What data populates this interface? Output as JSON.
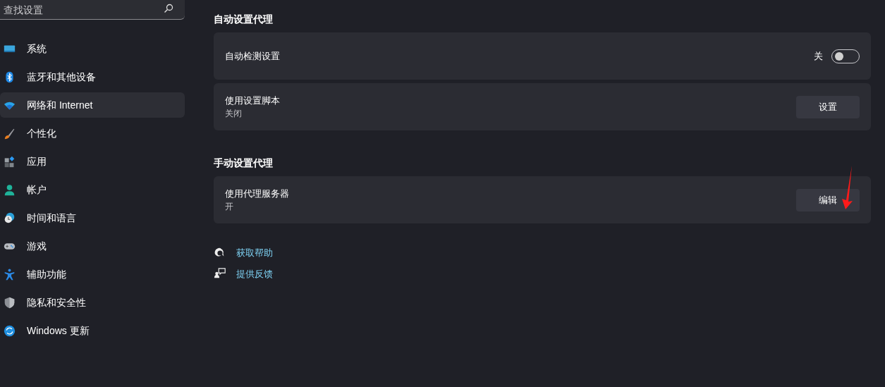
{
  "search": {
    "placeholder": "查找设置"
  },
  "sidebar": {
    "items": [
      {
        "label": "系统",
        "selected": false
      },
      {
        "label": "蓝牙和其他设备",
        "selected": false
      },
      {
        "label": "网络和 Internet",
        "selected": true
      },
      {
        "label": "个性化",
        "selected": false
      },
      {
        "label": "应用",
        "selected": false
      },
      {
        "label": "帐户",
        "selected": false
      },
      {
        "label": "时间和语言",
        "selected": false
      },
      {
        "label": "游戏",
        "selected": false
      },
      {
        "label": "辅助功能",
        "selected": false
      },
      {
        "label": "隐私和安全性",
        "selected": false
      },
      {
        "label": "Windows 更新",
        "selected": false
      }
    ]
  },
  "sections": [
    {
      "title": "自动设置代理",
      "cards": [
        {
          "kind": "toggle",
          "label": "自动检测设置",
          "state_text": "关",
          "on": false
        },
        {
          "kind": "button",
          "label": "使用设置脚本",
          "subtitle": "关闭",
          "button": "设置"
        }
      ]
    },
    {
      "title": "手动设置代理",
      "cards": [
        {
          "kind": "button",
          "label": "使用代理服务器",
          "subtitle": "开",
          "button": "编辑"
        }
      ]
    }
  ],
  "links": [
    "获取帮助",
    "提供反馈"
  ]
}
